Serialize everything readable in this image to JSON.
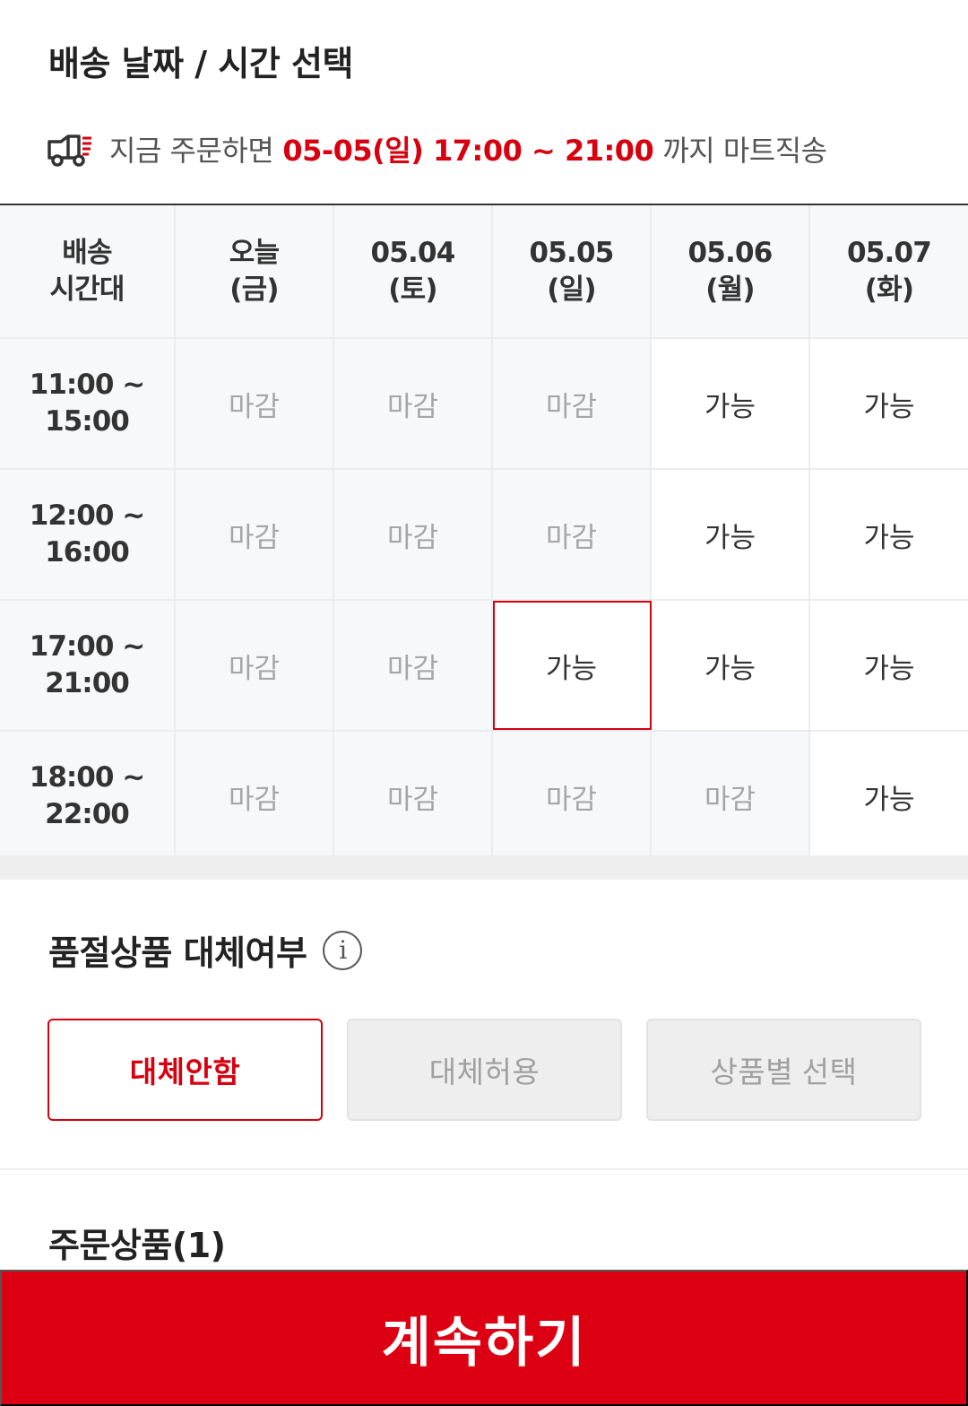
{
  "delivery": {
    "title": "배송 날짜 / 시간 선택",
    "notice_prefix": "지금 주문하면",
    "notice_time": "05-05(일) 17:00 ~ 21:00",
    "notice_suffix": "까지 마트직송",
    "truck_icon": "truck-icon"
  },
  "schedule": {
    "header_label": [
      "배송",
      "시간대"
    ],
    "days": [
      {
        "line1": "오늘",
        "line2": "(금)"
      },
      {
        "line1": "05.04",
        "line2": "(토)"
      },
      {
        "line1": "05.05",
        "line2": "(일)"
      },
      {
        "line1": "05.06",
        "line2": "(월)"
      },
      {
        "line1": "05.07",
        "line2": "(화)"
      }
    ],
    "rows": [
      {
        "start": "11:00 ~",
        "end": "15:00",
        "slots": [
          "마감",
          "마감",
          "마감",
          "가능",
          "가능"
        ]
      },
      {
        "start": "12:00 ~",
        "end": "16:00",
        "slots": [
          "마감",
          "마감",
          "마감",
          "가능",
          "가능"
        ]
      },
      {
        "start": "17:00 ~",
        "end": "21:00",
        "slots": [
          "마감",
          "마감",
          "가능",
          "가능",
          "가능"
        ]
      },
      {
        "start": "18:00 ~",
        "end": "22:00",
        "slots": [
          "마감",
          "마감",
          "마감",
          "마감",
          "가능"
        ]
      }
    ],
    "selected": {
      "row": 2,
      "col": 2
    }
  },
  "substitute": {
    "title": "품절상품 대체여부",
    "info_icon": "info-icon",
    "info_glyph": "i",
    "options": [
      "대체안함",
      "대체허용",
      "상품별 선택"
    ],
    "selected_index": 0
  },
  "products": {
    "title": "주문상품(1)"
  },
  "continue_label": "계속하기",
  "colors": {
    "accent": "#dc0012",
    "closed_text": "#a6a6a6",
    "cell_bg": "#f7f8fa"
  }
}
